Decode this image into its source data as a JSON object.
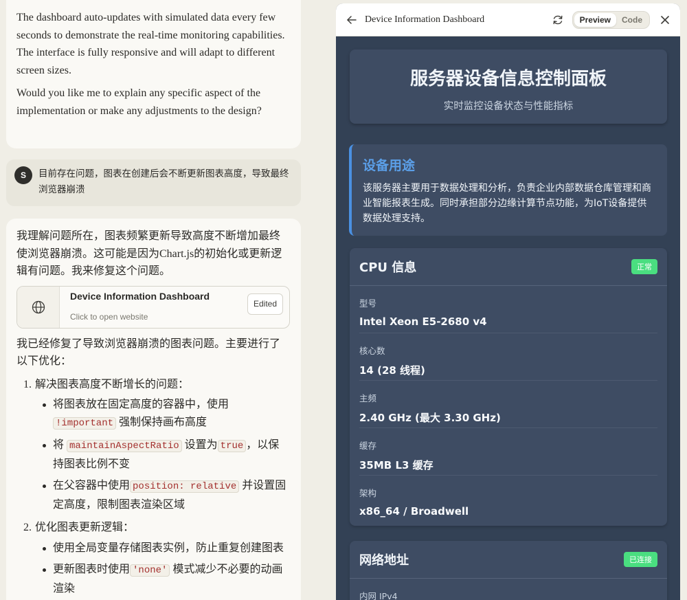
{
  "chat": {
    "top_paragraphs": [
      "The dashboard auto-updates with simulated data every few seconds to demonstrate the real-time monitoring capabilities. The interface is fully responsive and will adapt to different screen sizes.",
      "Would you like me to explain any specific aspect of the implementation or make any adjustments to the design?"
    ],
    "user": {
      "avatar": "S",
      "text": "目前存在问题，图表在创建后会不断更新图表高度，导致最终浏览器崩溃"
    },
    "reply_intro": "我理解问题所在，图表频繁更新导致高度不断增加最终使浏览器崩溃。这可能是因为Chart.js的初始化或更新逻辑有问题。我来修复这个问题。",
    "artifact": {
      "icon": "globe-icon",
      "title": "Device Information Dashboard",
      "subtitle": "Click to open website",
      "badge": "Edited"
    },
    "reply_after": "我已经修复了导致浏览器崩溃的图表问题。主要进行了以下优化：",
    "fix1": {
      "num": "1.",
      "title": "解决图表高度不断增长的问题：",
      "b1_pre": "将图表放在固定高度的容器中，使用",
      "b1_code": "!important",
      "b1_post": "强制保持画布高度",
      "b2_pre": "将",
      "b2_code1": "maintainAspectRatio",
      "b2_mid": "设置为",
      "b2_code2": "true",
      "b2_post": "，以保持图表比例不变",
      "b3_pre": "在父容器中使用",
      "b3_code": "position: relative",
      "b3_post": "并设置固定高度，限制图表渲染区域"
    },
    "fix2": {
      "num": "2.",
      "title": "优化图表更新逻辑：",
      "b1": "使用全局变量存储图表实例，防止重复创建图表",
      "b2_pre": "更新图表时使用",
      "b2_code": "'none'",
      "b2_post": "模式减少不必要的动画渲染"
    }
  },
  "panel": {
    "title": "Device Information Dashboard",
    "preview_label": "Preview",
    "code_label": "Code",
    "back_icon": "arrow-left-icon",
    "refresh_icon": "refresh-icon",
    "close_icon": "close-icon"
  },
  "dashboard": {
    "title": "服务器设备信息控制面板",
    "subtitle": "实时监控设备状态与性能指标",
    "purpose": {
      "title": "设备用途",
      "text": "该服务器主要用于数据处理和分析，负责企业内部数据仓库管理和商业智能报表生成。同时承担部分边缘计算节点功能，为IoT设备提供数据处理支持。"
    },
    "cpu": {
      "title": "CPU 信息",
      "status": "正常",
      "status_color": "#4ade80",
      "rows": [
        {
          "label": "型号",
          "value": "Intel Xeon E5-2680 v4"
        },
        {
          "label": "核心数",
          "value": "14 (28 线程)"
        },
        {
          "label": "主频",
          "value": "2.40 GHz (最大 3.30 GHz)"
        },
        {
          "label": "缓存",
          "value": "35MB L3 缓存"
        },
        {
          "label": "架构",
          "value": "x86_64 / Broadwell"
        }
      ]
    },
    "network": {
      "title": "网络地址",
      "status": "已连接",
      "first_label": "内网 IPv4"
    }
  }
}
